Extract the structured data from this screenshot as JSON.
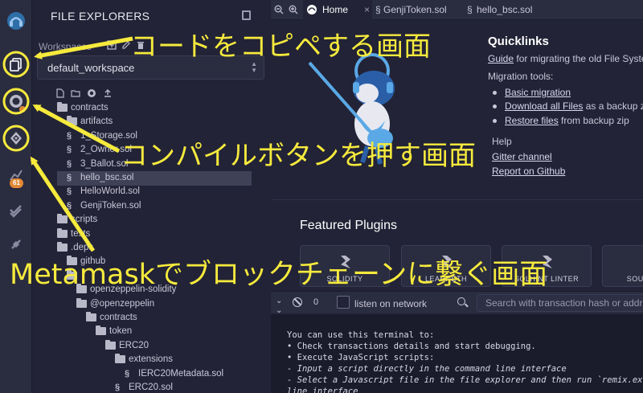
{
  "rail": {
    "badge_count": "61",
    "icons": [
      "remix-logo-icon",
      "file-explorer-icon",
      "solidity-compiler-icon",
      "deploy-run-icon",
      "analysis-icon",
      "verify-icon",
      "plugin-icon"
    ]
  },
  "explorer": {
    "title": "FILE EXPLORERS",
    "workspaces_label": "Workspaces",
    "workspace_selected": "default_workspace",
    "tree": [
      {
        "label": "contracts",
        "type": "folder"
      },
      {
        "label": "artifacts",
        "type": "folder"
      },
      {
        "label": "1_Storage.sol",
        "type": "sol"
      },
      {
        "label": "2_Owner.sol",
        "type": "sol"
      },
      {
        "label": "3_Ballot.sol",
        "type": "sol"
      },
      {
        "label": "hello_bsc.sol",
        "type": "sol",
        "selected": true
      },
      {
        "label": "HelloWorld.sol",
        "type": "sol"
      },
      {
        "label": "GenjiToken.sol",
        "type": "sol"
      },
      {
        "label": "scripts",
        "type": "folder"
      },
      {
        "label": "tests",
        "type": "folder"
      },
      {
        "label": ".deps",
        "type": "folder"
      },
      {
        "label": "github",
        "type": "folder"
      },
      {
        "label": "",
        "type": "folder"
      },
      {
        "label": "openzeppelin-solidity",
        "type": "folder"
      },
      {
        "label": "@openzeppelin",
        "type": "folder"
      },
      {
        "label": "contracts",
        "type": "folder"
      },
      {
        "label": "token",
        "type": "folder"
      },
      {
        "label": "ERC20",
        "type": "folder"
      },
      {
        "label": "extensions",
        "type": "folder"
      },
      {
        "label": "IERC20Metadata.sol",
        "type": "sol"
      },
      {
        "label": "ERC20.sol",
        "type": "sol"
      }
    ]
  },
  "tabs": {
    "home": "Home",
    "file1": "GenjiToken.sol",
    "file2": "hello_bsc.sol",
    "close": "×"
  },
  "home": {
    "quicklinks_title": "Quicklinks",
    "guide_link": "Guide",
    "guide_text": "for migrating the old File Syste",
    "migration_tools": "Migration tools:",
    "basic_migration": "Basic migration",
    "download_all": "Download all Files",
    "download_suffix": "as a backup z",
    "restore_files": "Restore files",
    "restore_suffix": "from backup zip",
    "help_title": "Help",
    "gitter_channel": "Gitter channel",
    "report_github": "Report on Github",
    "featured_title": "Featured Plugins",
    "plugins": [
      "SOLIDITY",
      "LEARNETH",
      "SOLHINT LINTER",
      "SOURCIFY"
    ]
  },
  "terminal": {
    "count": "0",
    "listen_label": "listen on network",
    "search_placeholder": "Search with transaction hash or address",
    "lines": [
      "You can use this terminal to:",
      " • Check transactions details and start debugging.",
      " • Execute JavaScript scripts:",
      "    - Input a script directly in the command line interface",
      "    - Select a Javascript file in the file explorer and then run `remix.execute()` or `remix.exeCurrent()` in the command",
      "  line interface"
    ]
  },
  "annotations": {
    "copy_code": "コードをコピペする画面",
    "compile": "コンパイルボタンを押す画面",
    "metamask": "Metamaskでブロックチェーンに繋ぐ画面",
    "color": "#f6ea3d"
  }
}
